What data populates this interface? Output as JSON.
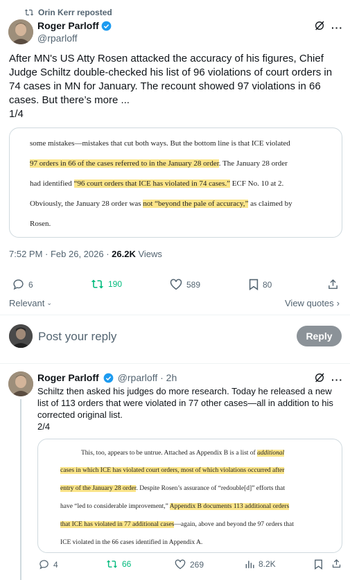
{
  "repost": {
    "label": "Orin Kerr reposted"
  },
  "main_tweet": {
    "author_name": "Roger Parloff",
    "handle": "@rparloff",
    "text_lines": [
      "After MN's US Atty Rosen attacked the accuracy of his figures, Chief",
      "Judge Schiltz double-checked his list of 96 violations of court orders in",
      "74 cases in MN for January. The recount showed 97 violations in 66",
      "cases. But there’s more ...",
      "1/4"
    ],
    "doc_excerpt": {
      "line1": "some mistakes—mistakes that cut both ways.  But the bottom line is that ICE violated",
      "line2_hl": "97 orders in 66 of the cases referred to in the January 28 order",
      "line2_rest": ".  The January 28 order",
      "line3_a": "had identified ",
      "line3_hl": "“96 court orders that ICE has violated in 74 cases.”",
      "line3_b": "  ECF No. 10 at 2.",
      "line4_a": "Obviously, the January 28 order was ",
      "line4_hl": "not “beyond the pale of accuracy,”",
      "line4_b": " as claimed by",
      "line5": "Rosen."
    },
    "timestamp": "7:52 PM · Feb 26, 2026 · ",
    "views_count": "26.2K",
    "views_label": " Views",
    "replies": "6",
    "reposts": "190",
    "likes": "589",
    "bookmarks": "80"
  },
  "sort": {
    "label": "Relevant"
  },
  "view_quotes": {
    "label": "View quotes"
  },
  "reply_box": {
    "placeholder": "Post your reply",
    "button": "Reply"
  },
  "reply_tweet": {
    "author_name": "Roger Parloff",
    "handle_time": "@rparloff · 2h",
    "text_lines": [
      "Schiltz then asked his judges do more research. Today he released a new",
      "list of 113 orders that were violated in 77 other cases—all in addition to his",
      "corrected original list.",
      "2/4"
    ],
    "doc_excerpt": {
      "l1_a": "This, too, appears to be untrue.  Attached as Appendix B is a list of ",
      "l1_hl": "additional",
      "l2_hl": "cases in which ICE has violated court orders, most of which violations occurred after",
      "l3_hl": "entry of the January 28 order",
      "l3_b": ".  Despite Rosen’s assurance of “redouble[d]” efforts that",
      "l4_a": "have “led to considerable improvement,” ",
      "l4_hl": "Appendix B documents 113 additional orders",
      "l5_hl": "that ICE has violated in 77 additional cases",
      "l5_b": "—again, above and beyond the 97 orders that",
      "l6": "ICE violated in the 66 cases identified in Appendix A."
    },
    "replies": "4",
    "reposts": "66",
    "likes": "269",
    "views": "8.2K"
  }
}
